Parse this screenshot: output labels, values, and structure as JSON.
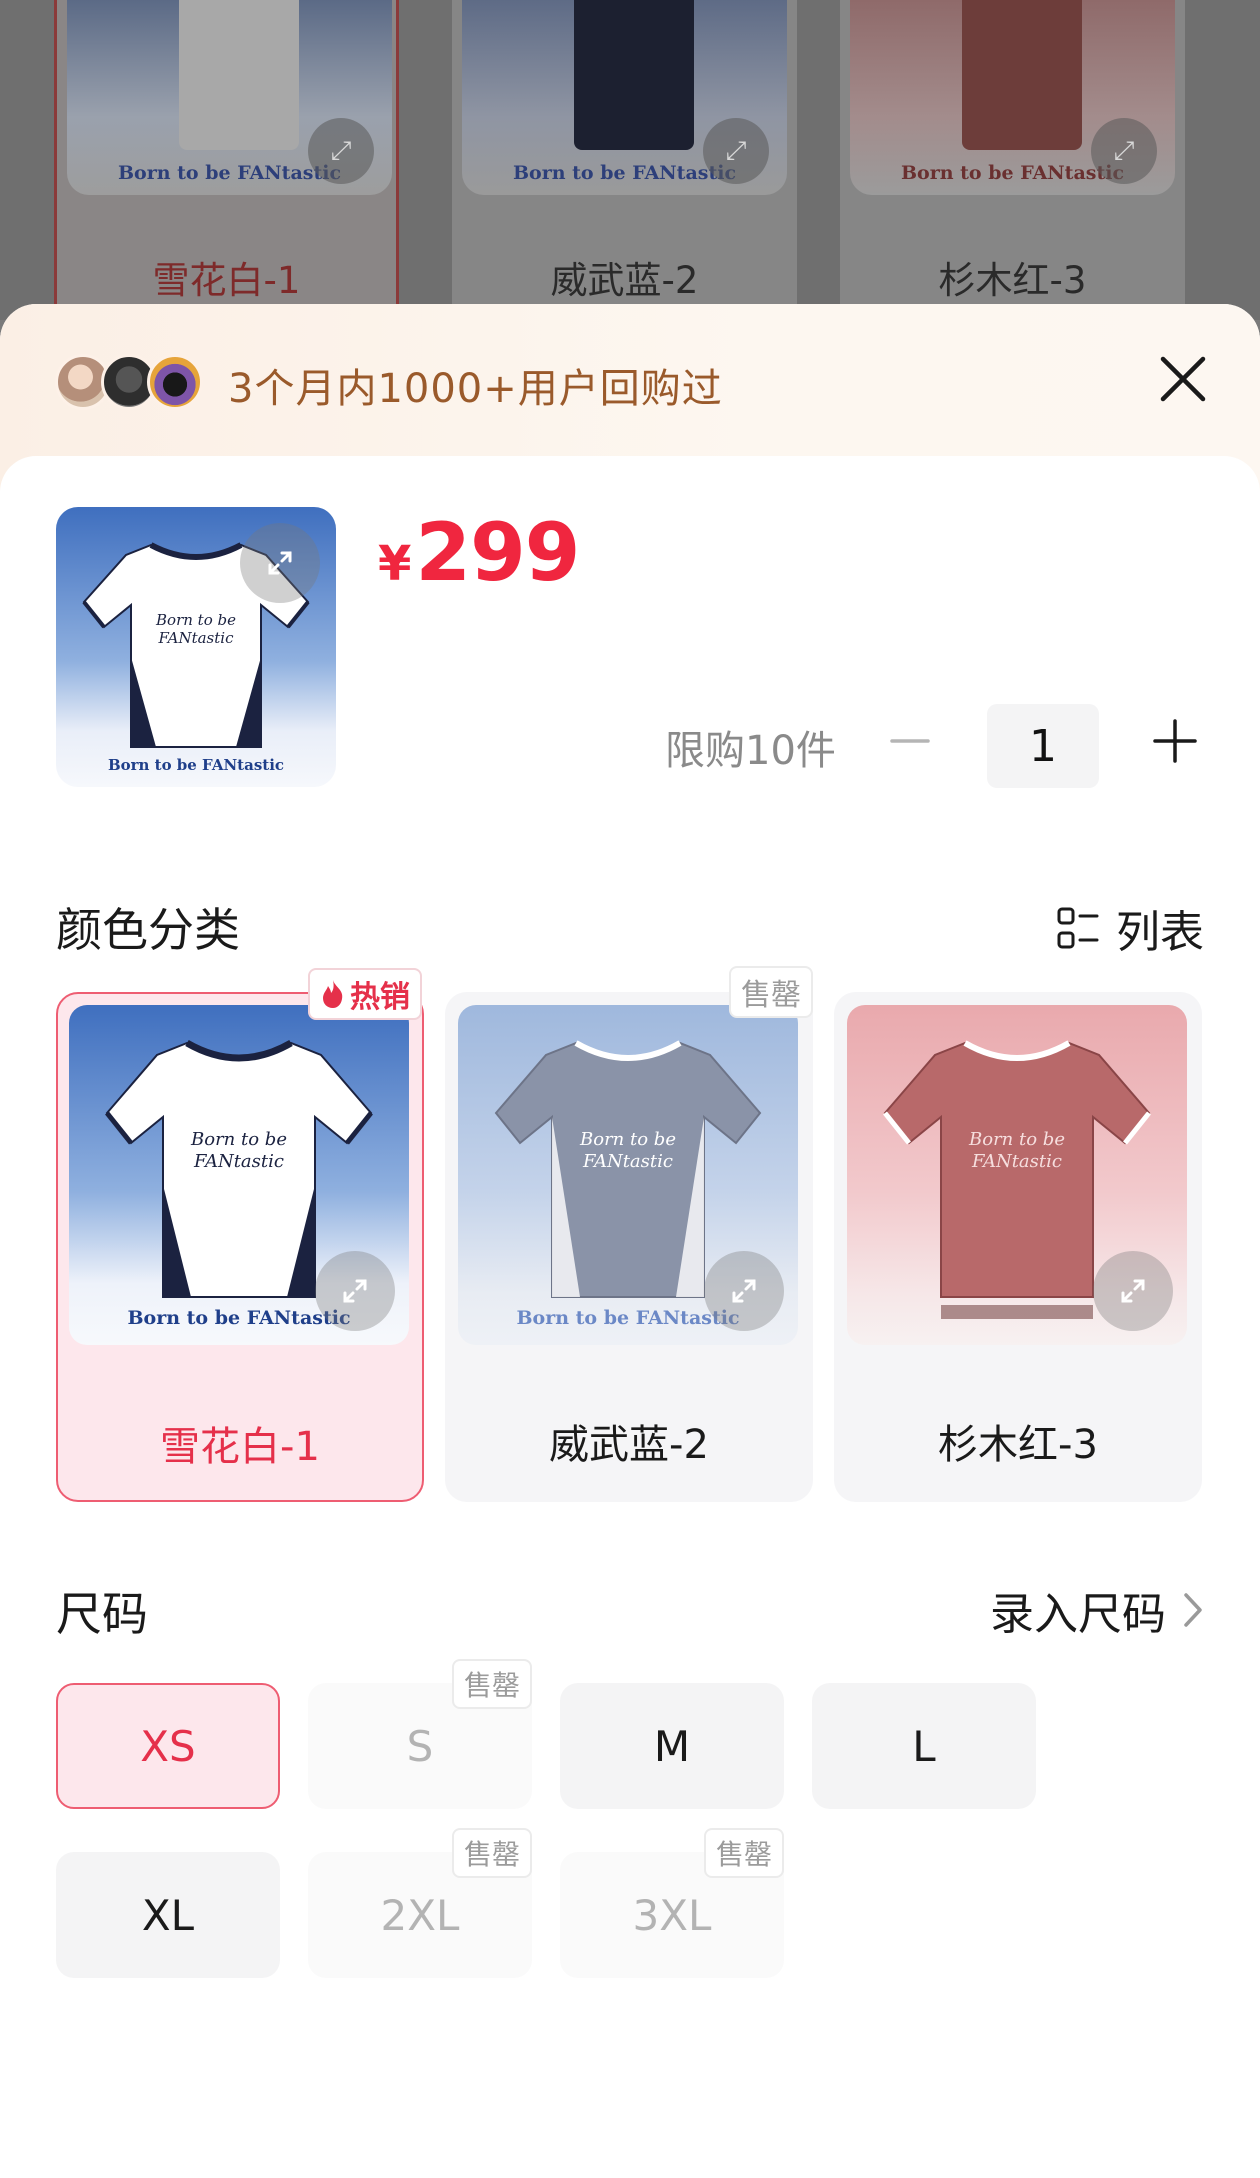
{
  "background": {
    "cards": [
      {
        "label": "雪花白-1",
        "brand": "Born to be FANtastic"
      },
      {
        "label": "威武蓝-2",
        "brand": "Born to be FANtastic"
      },
      {
        "label": "杉木红-3",
        "brand": "Born to be FANtastic"
      }
    ]
  },
  "sheet": {
    "buyer_text": "3个月内1000+用户回购过",
    "price_currency": "¥",
    "price_amount": "299",
    "product_brand": "Born to be FANtastic",
    "limit_text": "限购10件",
    "quantity": "1",
    "color_section": {
      "title": "颜色分类",
      "list_label": "列表",
      "options": [
        {
          "label": "雪花白-1",
          "badge": "热销",
          "brand": "Born to be FANtastic",
          "selected": true
        },
        {
          "label": "威武蓝-2",
          "badge": "售罄",
          "brand": "Born to be FANtastic",
          "selected": false
        },
        {
          "label": "杉木红-3",
          "badge": "",
          "brand": "",
          "selected": false
        }
      ]
    },
    "size_section": {
      "title": "尺码",
      "enter_size_label": "录入尺码",
      "sizes": [
        {
          "label": "XS",
          "state": "selected",
          "badge": ""
        },
        {
          "label": "S",
          "state": "sold_out",
          "badge": "售罄"
        },
        {
          "label": "M",
          "state": "available",
          "badge": ""
        },
        {
          "label": "L",
          "state": "available",
          "badge": ""
        },
        {
          "label": "XL",
          "state": "available",
          "badge": ""
        },
        {
          "label": "2XL",
          "state": "sold_out",
          "badge": "售罄"
        },
        {
          "label": "3XL",
          "state": "sold_out",
          "badge": "售罄"
        }
      ]
    }
  },
  "colors": {
    "accent": "#e5304a",
    "price": "#f0263f",
    "buyer_text": "#9a5a2b",
    "selected_bg": "#fde7ec"
  }
}
